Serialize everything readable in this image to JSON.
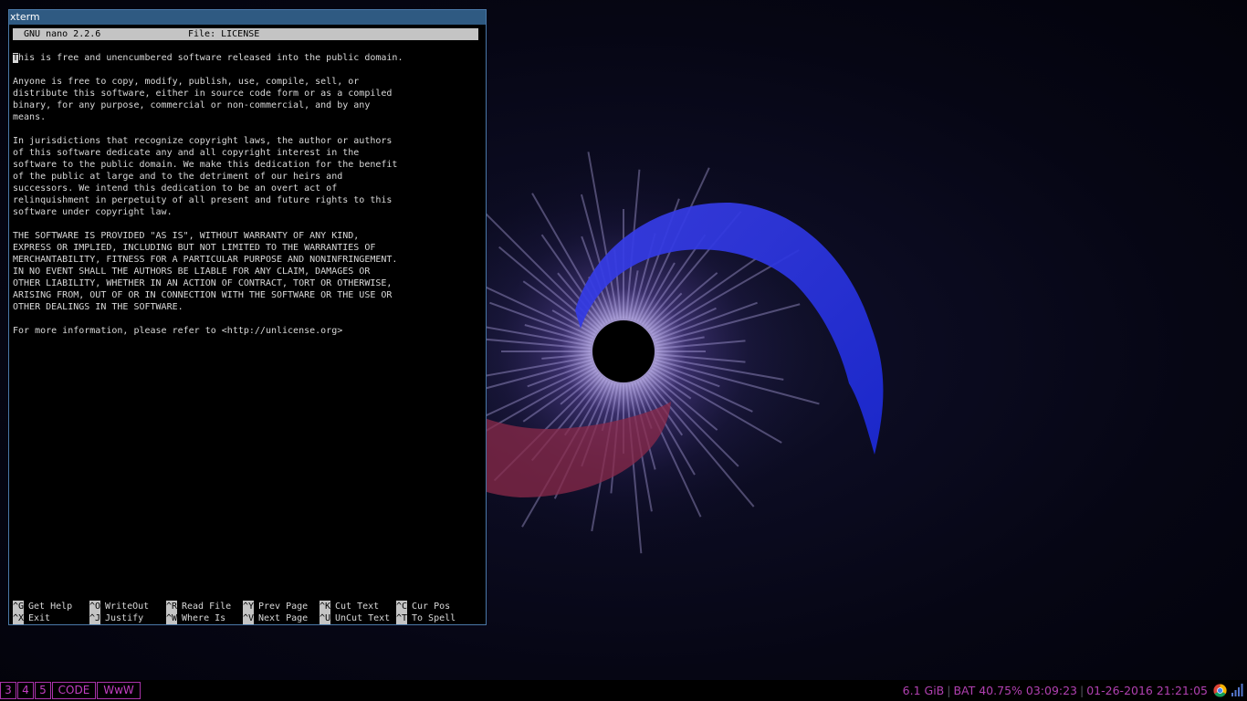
{
  "window": {
    "title": "xterm"
  },
  "nano": {
    "version": "GNU nano 2.2.6",
    "filename": "File: LICENSE",
    "lines": [
      "This is free and unencumbered software released into the public domain.",
      "",
      "Anyone is free to copy, modify, publish, use, compile, sell, or",
      "distribute this software, either in source code form or as a compiled",
      "binary, for any purpose, commercial or non-commercial, and by any",
      "means.",
      "",
      "In jurisdictions that recognize copyright laws, the author or authors",
      "of this software dedicate any and all copyright interest in the",
      "software to the public domain. We make this dedication for the benefit",
      "of the public at large and to the detriment of our heirs and",
      "successors. We intend this dedication to be an overt act of",
      "relinquishment in perpetuity of all present and future rights to this",
      "software under copyright law.",
      "",
      "THE SOFTWARE IS PROVIDED \"AS IS\", WITHOUT WARRANTY OF ANY KIND,",
      "EXPRESS OR IMPLIED, INCLUDING BUT NOT LIMITED TO THE WARRANTIES OF",
      "MERCHANTABILITY, FITNESS FOR A PARTICULAR PURPOSE AND NONINFRINGEMENT.",
      "IN NO EVENT SHALL THE AUTHORS BE LIABLE FOR ANY CLAIM, DAMAGES OR",
      "OTHER LIABILITY, WHETHER IN AN ACTION OF CONTRACT, TORT OR OTHERWISE,",
      "ARISING FROM, OUT OF OR IN CONNECTION WITH THE SOFTWARE OR THE USE OR",
      "OTHER DEALINGS IN THE SOFTWARE.",
      "",
      "For more information, please refer to <http://unlicense.org>"
    ],
    "shortcuts": [
      {
        "key": "^G",
        "label": "Get Help"
      },
      {
        "key": "^X",
        "label": "Exit"
      },
      {
        "key": "^O",
        "label": "WriteOut"
      },
      {
        "key": "^J",
        "label": "Justify"
      },
      {
        "key": "^R",
        "label": "Read File"
      },
      {
        "key": "^W",
        "label": "Where Is"
      },
      {
        "key": "^Y",
        "label": "Prev Page"
      },
      {
        "key": "^V",
        "label": "Next Page"
      },
      {
        "key": "^K",
        "label": "Cut Text"
      },
      {
        "key": "^U",
        "label": "UnCut Text"
      },
      {
        "key": "^C",
        "label": "Cur Pos"
      },
      {
        "key": "^T",
        "label": "To Spell"
      }
    ]
  },
  "taskbar": {
    "workspaces": [
      "3",
      "4",
      "5",
      "CODE",
      "WwW"
    ],
    "memory": "6.1 GiB",
    "battery": "BAT 40.75% 03:09:23",
    "datetime": "01-26-2016 21:21:05",
    "accent_color": "#b040b0"
  },
  "tray_icons": [
    "chrome-icon",
    "signal-strength-icon"
  ]
}
